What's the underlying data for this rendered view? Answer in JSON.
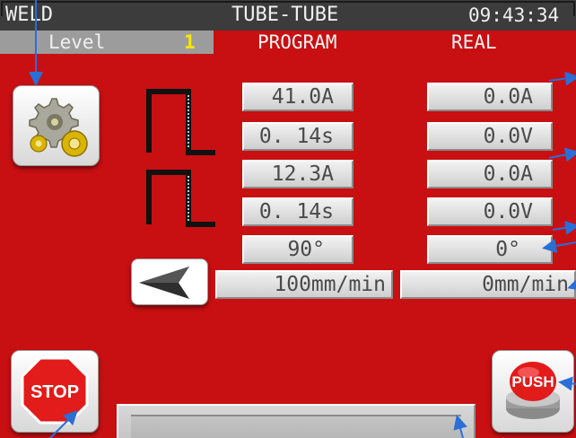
{
  "header": {
    "mode": "WELD",
    "title": "TUBE-TUBE",
    "clock": "09:43:34"
  },
  "subheader": {
    "level_label": "Level",
    "level_value": "1",
    "program_label": "PROGRAM",
    "real_label": "REAL"
  },
  "program": {
    "current_1": "41.0A",
    "time_1": "0. 14s",
    "current_2": "12.3A",
    "time_2": "0. 14s",
    "angle": "90°",
    "speed": "100mm/min"
  },
  "real": {
    "current_1": "0.0A",
    "voltage_1": "0.0V",
    "current_2": "0.0A",
    "voltage_2": "0.0V",
    "angle": "0°",
    "speed": "0mm/min"
  },
  "buttons": {
    "stop_label": "STOP",
    "push_label": "PUSH"
  },
  "icons": {
    "settings": "gears-icon",
    "back": "arrow-left-icon",
    "pulse": "pulse-waveform-icon",
    "stop": "stop-sign-icon",
    "push": "push-button-icon"
  },
  "colors": {
    "background": "#c80f12",
    "header": "#3c3c3c",
    "level_value": "#ffe600",
    "pointer": "#2a6fd6"
  }
}
